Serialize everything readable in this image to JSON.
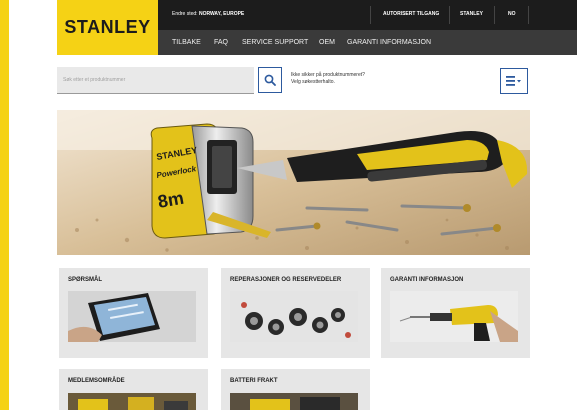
{
  "header": {
    "logo": "STANLEY",
    "region_prefix": "Endre sted:",
    "region_value": "NORWAY, EUROPE",
    "top_links": [
      "AUTORISERT TILGANG",
      "STANLEY",
      "NO"
    ]
  },
  "nav": {
    "items": [
      "TILBAKE",
      "FAQ",
      "SERVICE SUPPORT",
      "OEM",
      "GARANTI INFORMASJON"
    ]
  },
  "search": {
    "placeholder": "Søk etter et produktnummer",
    "help_line1": "Ikke sikker på produktnummeret?",
    "help_line2": "Velg søkestterhalto."
  },
  "cards": [
    {
      "title": "SPØRSMÅL"
    },
    {
      "title": "REPERASJONER OG RESERVEDELER"
    },
    {
      "title": "GARANTI INFORMASJON"
    },
    {
      "title": "MEDLEMSOMRÅDE"
    },
    {
      "title": "BATTERI FRAKT"
    }
  ],
  "hero": {
    "tape_brand": "STANLEY",
    "tape_model": "Powerlock",
    "tape_size": "8m"
  },
  "colors": {
    "brand_yellow": "#f5d215",
    "header_dark": "#1c1c1c",
    "nav_dark": "#3a3a3a",
    "accent_blue": "#2d5a9e"
  }
}
